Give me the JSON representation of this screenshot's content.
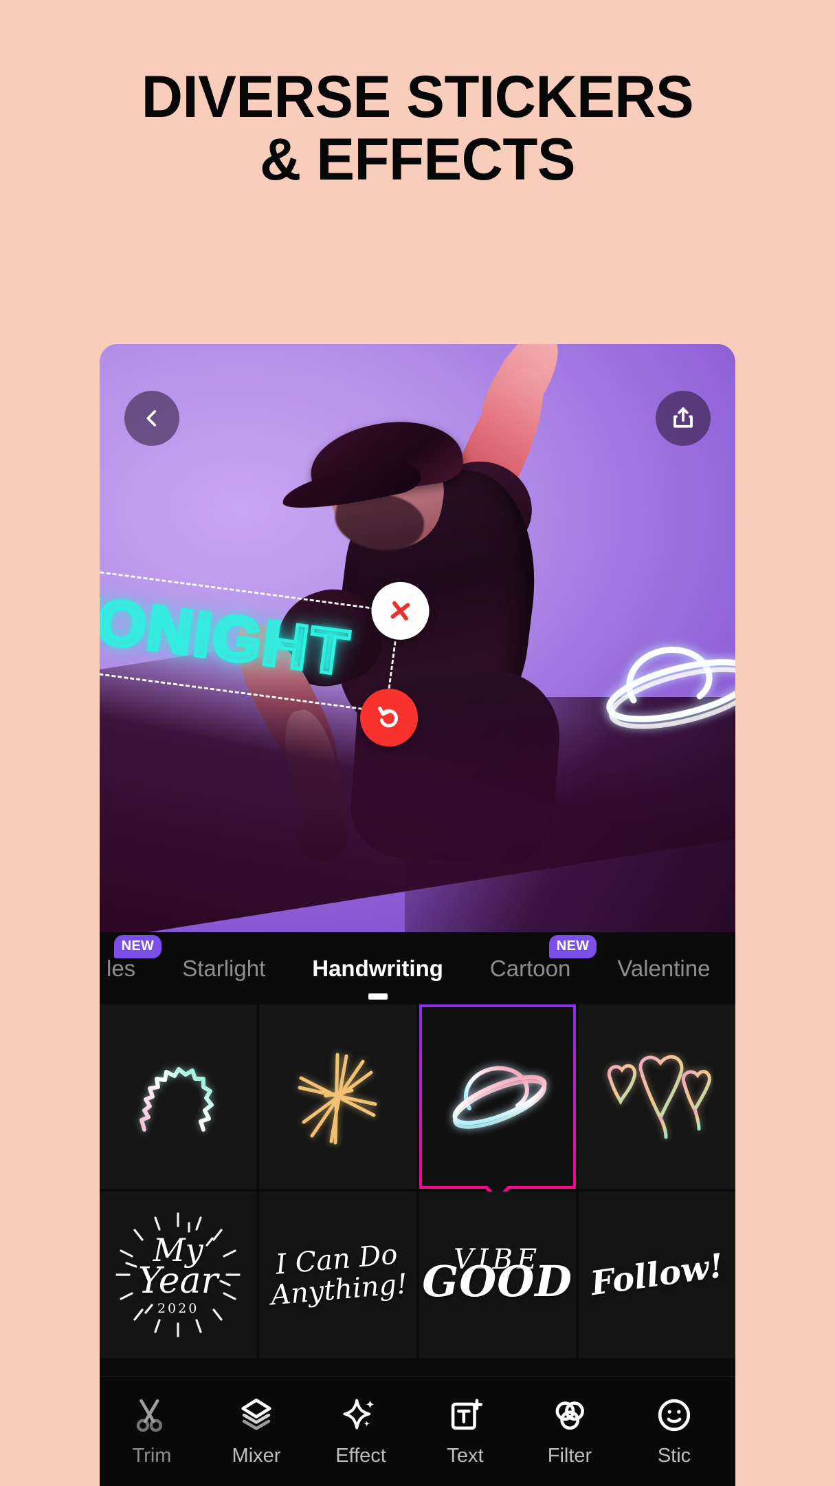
{
  "background_color": "#f8cdbb",
  "headline": {
    "line1": "DIVERSE STICKERS",
    "line2": "& EFFECTS",
    "color": "#070707"
  },
  "preview": {
    "back_button": {
      "icon": "chevron-left-icon",
      "label": "Back"
    },
    "share_button": {
      "icon": "share-upload-icon",
      "label": "Share"
    },
    "applied_stickers": [
      {
        "name": "saturn-planet-neon-sticker",
        "style": "neon-outline",
        "colors": [
          "#d9f7f2",
          "#c9e8ff"
        ]
      }
    ],
    "text_object": {
      "value": "TONIGHT",
      "style": "neon-outline",
      "color": "#2ef0e0",
      "rotation_deg": 7.5,
      "selected": true,
      "handles": [
        {
          "name": "edit-handle",
          "icon": "pencil-icon",
          "color": "#f8332e"
        },
        {
          "name": "delete-handle",
          "icon": "close-x-icon",
          "color": "#ffffff",
          "glyph_color": "#e8312c"
        },
        {
          "name": "rotate-handle",
          "icon": "rotate-undo-icon",
          "color": "#f8332e"
        }
      ]
    }
  },
  "sticker_panel": {
    "tabs": [
      {
        "label": "les",
        "active": false,
        "badge": "NEW",
        "truncated": true
      },
      {
        "label": "Starlight",
        "active": false,
        "badge": null
      },
      {
        "label": "Handwriting",
        "active": true,
        "badge": null
      },
      {
        "label": "Cartoon",
        "active": false,
        "badge": "NEW"
      },
      {
        "label": "Valentine",
        "active": false,
        "badge": null,
        "truncated": true
      }
    ],
    "badge_color": "#7b4fe8",
    "selection_border_gradient": [
      "#8b2fe8",
      "#ff0090"
    ],
    "row1": [
      {
        "name": "cloud-scribble-sticker",
        "selected": false,
        "colors": [
          "#7fe8d2",
          "#f3c8e6"
        ]
      },
      {
        "name": "starburst-sticker",
        "selected": false,
        "colors": [
          "#f3c57a",
          "#f7e0a8"
        ]
      },
      {
        "name": "saturn-planet-sticker",
        "selected": true,
        "colors": [
          "#b9f0e4",
          "#f09ab4"
        ]
      },
      {
        "name": "double-heart-sticker",
        "selected": false,
        "colors": [
          "#f2c98a",
          "#f0a8c4"
        ]
      }
    ],
    "row2": [
      {
        "name": "my-year-2020-lettering",
        "lines": [
          "My",
          "Year",
          "2020"
        ],
        "decoration": "sunburst"
      },
      {
        "name": "i-can-do-anything-lettering",
        "lines": [
          "I Can Do",
          "Anything!"
        ]
      },
      {
        "name": "vibe-good-lettering",
        "lines": [
          "VIBE",
          "GOOD"
        ]
      },
      {
        "name": "follow-lettering",
        "lines": [
          "Follow!"
        ]
      }
    ]
  },
  "toolbar": {
    "items": [
      {
        "label": "Trim",
        "icon": "scissors-icon"
      },
      {
        "label": "Mixer",
        "icon": "layers-icon"
      },
      {
        "label": "Effect",
        "icon": "sparkles-icon"
      },
      {
        "label": "Text",
        "icon": "text-add-icon"
      },
      {
        "label": "Filter",
        "icon": "filter-circles-icon"
      },
      {
        "label": "Stic",
        "icon": "sticker-smiley-icon",
        "truncated": true
      }
    ]
  }
}
